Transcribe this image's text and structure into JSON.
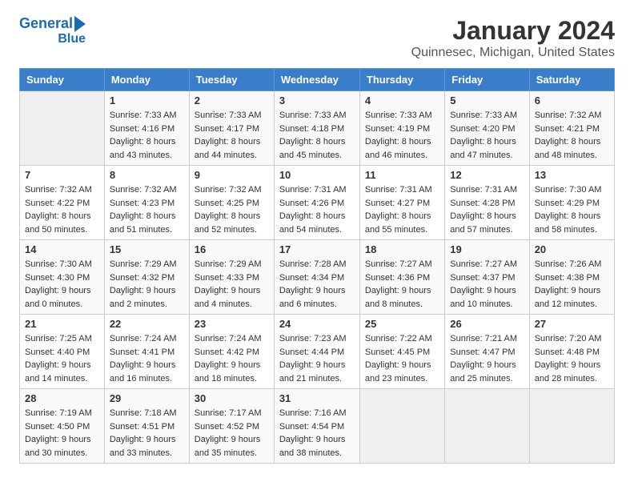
{
  "logo": {
    "line1": "General",
    "line2": "Blue"
  },
  "title": "January 2024",
  "subtitle": "Quinnesec, Michigan, United States",
  "days_of_week": [
    "Sunday",
    "Monday",
    "Tuesday",
    "Wednesday",
    "Thursday",
    "Friday",
    "Saturday"
  ],
  "weeks": [
    [
      {
        "day": "",
        "sunrise": "",
        "sunset": "",
        "daylight": ""
      },
      {
        "day": "1",
        "sunrise": "7:33 AM",
        "sunset": "4:16 PM",
        "daylight": "8 hours and 43 minutes."
      },
      {
        "day": "2",
        "sunrise": "7:33 AM",
        "sunset": "4:17 PM",
        "daylight": "8 hours and 44 minutes."
      },
      {
        "day": "3",
        "sunrise": "7:33 AM",
        "sunset": "4:18 PM",
        "daylight": "8 hours and 45 minutes."
      },
      {
        "day": "4",
        "sunrise": "7:33 AM",
        "sunset": "4:19 PM",
        "daylight": "8 hours and 46 minutes."
      },
      {
        "day": "5",
        "sunrise": "7:33 AM",
        "sunset": "4:20 PM",
        "daylight": "8 hours and 47 minutes."
      },
      {
        "day": "6",
        "sunrise": "7:32 AM",
        "sunset": "4:21 PM",
        "daylight": "8 hours and 48 minutes."
      }
    ],
    [
      {
        "day": "7",
        "sunrise": "7:32 AM",
        "sunset": "4:22 PM",
        "daylight": "8 hours and 50 minutes."
      },
      {
        "day": "8",
        "sunrise": "7:32 AM",
        "sunset": "4:23 PM",
        "daylight": "8 hours and 51 minutes."
      },
      {
        "day": "9",
        "sunrise": "7:32 AM",
        "sunset": "4:25 PM",
        "daylight": "8 hours and 52 minutes."
      },
      {
        "day": "10",
        "sunrise": "7:31 AM",
        "sunset": "4:26 PM",
        "daylight": "8 hours and 54 minutes."
      },
      {
        "day": "11",
        "sunrise": "7:31 AM",
        "sunset": "4:27 PM",
        "daylight": "8 hours and 55 minutes."
      },
      {
        "day": "12",
        "sunrise": "7:31 AM",
        "sunset": "4:28 PM",
        "daylight": "8 hours and 57 minutes."
      },
      {
        "day": "13",
        "sunrise": "7:30 AM",
        "sunset": "4:29 PM",
        "daylight": "8 hours and 58 minutes."
      }
    ],
    [
      {
        "day": "14",
        "sunrise": "7:30 AM",
        "sunset": "4:30 PM",
        "daylight": "9 hours and 0 minutes."
      },
      {
        "day": "15",
        "sunrise": "7:29 AM",
        "sunset": "4:32 PM",
        "daylight": "9 hours and 2 minutes."
      },
      {
        "day": "16",
        "sunrise": "7:29 AM",
        "sunset": "4:33 PM",
        "daylight": "9 hours and 4 minutes."
      },
      {
        "day": "17",
        "sunrise": "7:28 AM",
        "sunset": "4:34 PM",
        "daylight": "9 hours and 6 minutes."
      },
      {
        "day": "18",
        "sunrise": "7:27 AM",
        "sunset": "4:36 PM",
        "daylight": "9 hours and 8 minutes."
      },
      {
        "day": "19",
        "sunrise": "7:27 AM",
        "sunset": "4:37 PM",
        "daylight": "9 hours and 10 minutes."
      },
      {
        "day": "20",
        "sunrise": "7:26 AM",
        "sunset": "4:38 PM",
        "daylight": "9 hours and 12 minutes."
      }
    ],
    [
      {
        "day": "21",
        "sunrise": "7:25 AM",
        "sunset": "4:40 PM",
        "daylight": "9 hours and 14 minutes."
      },
      {
        "day": "22",
        "sunrise": "7:24 AM",
        "sunset": "4:41 PM",
        "daylight": "9 hours and 16 minutes."
      },
      {
        "day": "23",
        "sunrise": "7:24 AM",
        "sunset": "4:42 PM",
        "daylight": "9 hours and 18 minutes."
      },
      {
        "day": "24",
        "sunrise": "7:23 AM",
        "sunset": "4:44 PM",
        "daylight": "9 hours and 21 minutes."
      },
      {
        "day": "25",
        "sunrise": "7:22 AM",
        "sunset": "4:45 PM",
        "daylight": "9 hours and 23 minutes."
      },
      {
        "day": "26",
        "sunrise": "7:21 AM",
        "sunset": "4:47 PM",
        "daylight": "9 hours and 25 minutes."
      },
      {
        "day": "27",
        "sunrise": "7:20 AM",
        "sunset": "4:48 PM",
        "daylight": "9 hours and 28 minutes."
      }
    ],
    [
      {
        "day": "28",
        "sunrise": "7:19 AM",
        "sunset": "4:50 PM",
        "daylight": "9 hours and 30 minutes."
      },
      {
        "day": "29",
        "sunrise": "7:18 AM",
        "sunset": "4:51 PM",
        "daylight": "9 hours and 33 minutes."
      },
      {
        "day": "30",
        "sunrise": "7:17 AM",
        "sunset": "4:52 PM",
        "daylight": "9 hours and 35 minutes."
      },
      {
        "day": "31",
        "sunrise": "7:16 AM",
        "sunset": "4:54 PM",
        "daylight": "9 hours and 38 minutes."
      },
      {
        "day": "",
        "sunrise": "",
        "sunset": "",
        "daylight": ""
      },
      {
        "day": "",
        "sunrise": "",
        "sunset": "",
        "daylight": ""
      },
      {
        "day": "",
        "sunrise": "",
        "sunset": "",
        "daylight": ""
      }
    ]
  ],
  "labels": {
    "sunrise": "Sunrise:",
    "sunset": "Sunset:",
    "daylight": "Daylight:"
  }
}
